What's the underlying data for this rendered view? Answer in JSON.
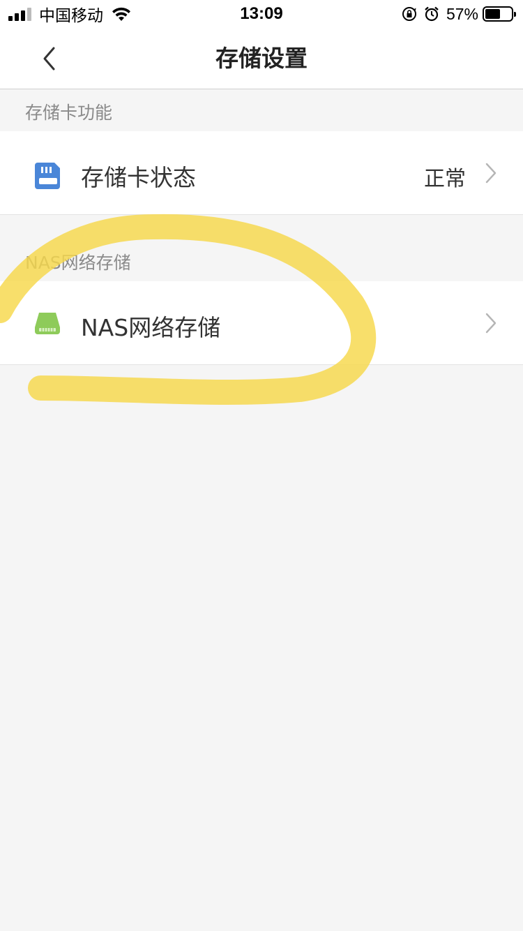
{
  "status_bar": {
    "carrier": "中国移动",
    "time": "13:09",
    "battery_percent": "57%",
    "battery_level": 0.57,
    "icons": [
      "signal-icon",
      "wifi-icon",
      "rotation-lock-icon",
      "alarm-icon",
      "battery-icon"
    ]
  },
  "nav": {
    "title": "存储设置",
    "back_icon": "chevron-left-icon"
  },
  "sections": [
    {
      "header": "存储卡功能",
      "rows": [
        {
          "label": "存储卡状态",
          "value": "正常",
          "icon": "sd-card-icon",
          "icon_color": "#4a86d8"
        }
      ]
    },
    {
      "header": "NAS网络存储",
      "rows": [
        {
          "label": "NAS网络存储",
          "value": "",
          "icon": "nas-drive-icon",
          "icon_color": "#8ecb5a"
        }
      ]
    }
  ],
  "colors": {
    "background": "#f5f5f5",
    "highlight_marker": "#f7d84a"
  }
}
